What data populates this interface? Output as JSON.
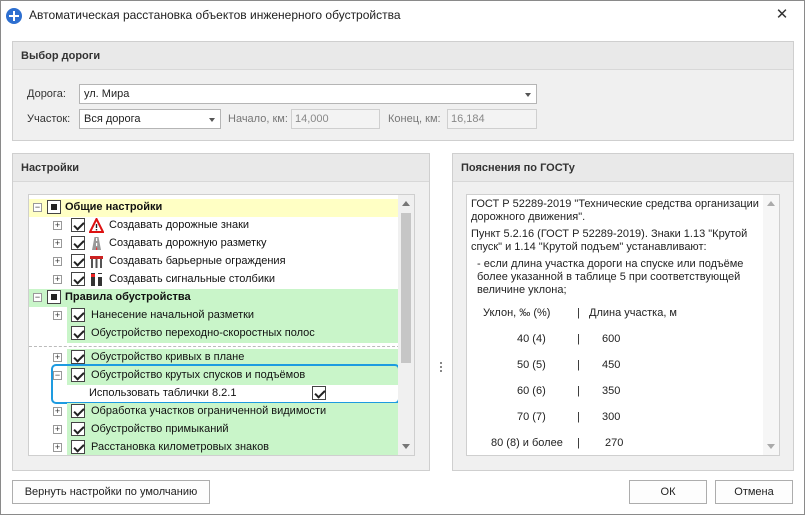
{
  "window": {
    "title": "Автоматическая расстановка объектов инженерного обустройства",
    "close_glyph": "✕"
  },
  "road_panel": {
    "header": "Выбор дороги",
    "road_label": "Дорога:",
    "road_value": "ул. Мира",
    "section_label": "Участок:",
    "section_value": "Вся дорога",
    "start_label": "Начало, км:",
    "start_value": "14,000",
    "end_label": "Конец, км:",
    "end_value": "16,184"
  },
  "settings_panel": {
    "header": "Настройки",
    "items": [
      {
        "label": "Общие настройки",
        "expander": "−",
        "check": "partial",
        "icon": "",
        "bg": "#ffffc4",
        "bold": true
      },
      {
        "label": "Создавать дорожные знаки",
        "expander": "+",
        "check": "checked",
        "icon": "warning-sign-icon",
        "bg": "",
        "bold": false
      },
      {
        "label": "Создавать дорожную разметку",
        "expander": "+",
        "check": "checked",
        "icon": "road-marking-icon",
        "bg": "",
        "bold": false
      },
      {
        "label": "Создавать барьерные ограждения",
        "expander": "+",
        "check": "checked",
        "icon": "barrier-icon",
        "bg": "",
        "bold": false
      },
      {
        "label": "Создавать сигнальные столбики",
        "expander": "+",
        "check": "checked",
        "icon": "signal-post-icon",
        "bg": "",
        "bold": false
      },
      {
        "label": "Правила обустройства",
        "expander": "−",
        "check": "partial",
        "icon": "",
        "bg": "#c9f5c9",
        "bold": true
      },
      {
        "label": "Нанесение начальной разметки",
        "expander": "+",
        "check": "checked",
        "icon": "",
        "bg": "#c9f5c9",
        "bold": false
      },
      {
        "label": "Обустройство переходно-скоростных полос",
        "expander": "",
        "check": "checked",
        "icon": "",
        "bg": "#c9f5c9",
        "bold": false
      },
      {
        "label": "Обустройство кривых в плане",
        "expander": "+",
        "check": "checked",
        "icon": "",
        "bg": "#c9f5c9",
        "bold": false
      },
      {
        "label": "Обустройство крутых спусков и подъёмов",
        "expander": "−",
        "check": "checked",
        "icon": "",
        "bg": "#c9f5c9",
        "bold": false
      },
      {
        "label": "Использовать таблички 8.2.1",
        "expander": "",
        "check": "checked",
        "icon": "",
        "bg": "",
        "bold": false
      },
      {
        "label": "Обработка участков ограниченной видимости",
        "expander": "+",
        "check": "checked",
        "icon": "",
        "bg": "#c9f5c9",
        "bold": false
      },
      {
        "label": "Обустройство примыканий",
        "expander": "+",
        "check": "checked",
        "icon": "",
        "bg": "#c9f5c9",
        "bold": false
      },
      {
        "label": "Расстановка километровых знаков",
        "expander": "+",
        "check": "checked",
        "icon": "",
        "bg": "#c9f5c9",
        "bold": false
      }
    ]
  },
  "gost_panel": {
    "header": "Пояснения по ГОСТу",
    "para1": "ГОСТ Р 52289-2019 \"Технические средства организации дорожного движения\".",
    "para2": "Пункт 5.2.16 (ГОСТ Р 52289-2019). Знаки 1.13 \"Крутой спуск\" и 1.14 \"Крутой подъем\" устанавливают:",
    "para3": "- если длина участка дороги на спуске или подъёме более указанной в таблице 5 при соответствующей величине уклона;",
    "table_header": {
      "c1": "Уклон, ‰ (%)",
      "sep": "|",
      "c2": "Длина участка, м"
    },
    "table_rows": [
      {
        "c1": "40 (4)",
        "sep": "|",
        "c2": "600"
      },
      {
        "c1": "50 (5)",
        "sep": "|",
        "c2": "450"
      },
      {
        "c1": "60 (6)",
        "sep": "|",
        "c2": "350"
      },
      {
        "c1": "70 (7)",
        "sep": "|",
        "c2": "300"
      },
      {
        "c1": "80 (8) и более",
        "sep": "|",
        "c2": "270"
      }
    ]
  },
  "buttons": {
    "reset": "Вернуть настройки по умолчанию",
    "ok": "ОК",
    "cancel": "Отмена"
  },
  "colors": {
    "highlight_border": "#1e9be0",
    "yellow_group": "#ffffc4",
    "green_group": "#c9f5c9"
  }
}
